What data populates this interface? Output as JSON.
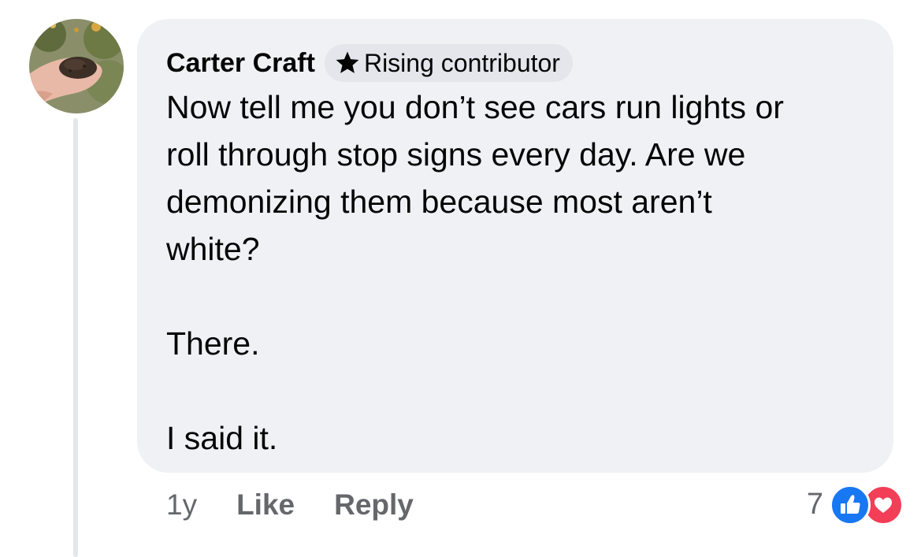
{
  "comment": {
    "author": "Carter Craft",
    "badge": {
      "icon": "star-icon",
      "label": "Rising contributor"
    },
    "lines": [
      "Now tell me you don’t see cars run lights or",
      "roll through stop signs every day.  Are we",
      "demonizing them because most aren’t",
      "white?"
    ],
    "paragraph_2": "There.",
    "paragraph_3": "I said it."
  },
  "actions": {
    "time": "1y",
    "like": "Like",
    "reply": "Reply"
  },
  "reactions": {
    "count": "7",
    "types": [
      "like-icon",
      "love-icon"
    ],
    "colors": {
      "like": "#1877f2",
      "love": "#f33e58"
    }
  },
  "colors": {
    "bubble": "#f0f1f5",
    "text": "#050505",
    "secondary_text": "#65676b",
    "badge_bg": "#e4e6eb"
  }
}
